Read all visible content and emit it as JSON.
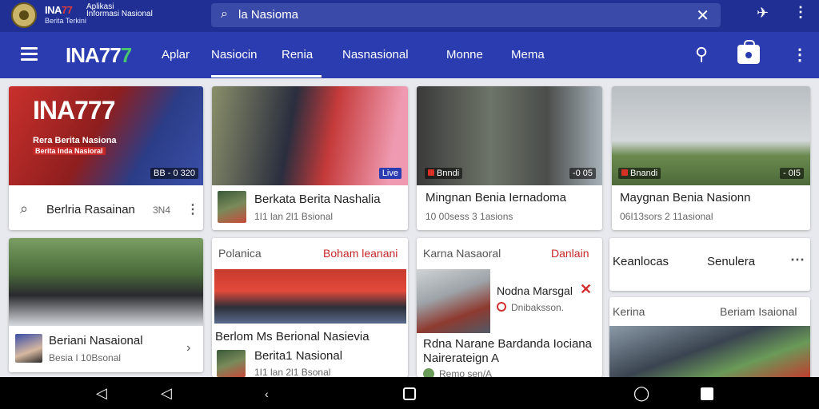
{
  "topbar": {
    "brand": "INA",
    "brand_accent": "77",
    "brand_line1": "Aplikasi",
    "brand_line2": "Informasi Nasional",
    "brand_line3": "Berita Terkini",
    "search_value": "la Nasioma",
    "search_icon": "search-icon",
    "clear_icon": "close-icon"
  },
  "nav": {
    "logo": "INA77",
    "logo_accent": "7",
    "tabs": [
      {
        "label": "Aplar"
      },
      {
        "label": "Nasiocin"
      },
      {
        "label": "Renia"
      },
      {
        "label": "Nasnasional"
      },
      {
        "label": "Monne"
      },
      {
        "label": "Mema"
      }
    ],
    "active_tab": "Nasiocin"
  },
  "cards": {
    "c1": {
      "overlay_title": "INA777",
      "overlay_caption": "Rera Berita Nasiona",
      "overlay_sub": "Berita Inda Nasioral",
      "chip": "BB - 0 320",
      "search_text": "Berlria Rasainan",
      "meta": "3N4"
    },
    "c2": {
      "chip": "Live",
      "title": "Berkata Berita Nashalia",
      "meta": "1I1 lan 2l1 Bsional"
    },
    "c3": {
      "chip_left": "Bnndi",
      "chip_right": "-0 05",
      "title": "Mingnan Benia Iernadoma",
      "meta": "10 00sess 3 1asions"
    },
    "c4": {
      "chip_left": "Bnandi",
      "chip_right": "- 0I5",
      "title": "Maygnan Benia Nasionn",
      "meta": "06I13sors 2 11asional"
    },
    "c5": {
      "title": "Beriani Nasaional",
      "meta": "Besia I 10Bsonal"
    },
    "c6": {
      "header_left": "Polanica",
      "header_right": "Boham leanani",
      "title": "Berlom Ms Berional Nasievia",
      "sub_title": "Berita1 Nasional",
      "meta": "1I1 lan 2l1 Bsonal"
    },
    "c7": {
      "header_left": "Karna Nasaoral",
      "header_right": "Danlain",
      "side_title": "Nodna Marsgal",
      "side_meta": "Dnibaksson.",
      "title_line1": "Rdna Narane Bardanda Iociana",
      "title_line2": "Nairerateign A",
      "meta": "Remo sen/A"
    },
    "c8": {
      "left": "Keanlocas",
      "right": "Senulera"
    },
    "c9": {
      "header_left": "Kerina",
      "header_right": "Beriam Isaional"
    }
  },
  "colors": {
    "topbar_bg": "#1f2f94",
    "navbar_bg": "#2a3cb0",
    "accent_red": "#c62828",
    "accent_green": "#47c46d"
  }
}
